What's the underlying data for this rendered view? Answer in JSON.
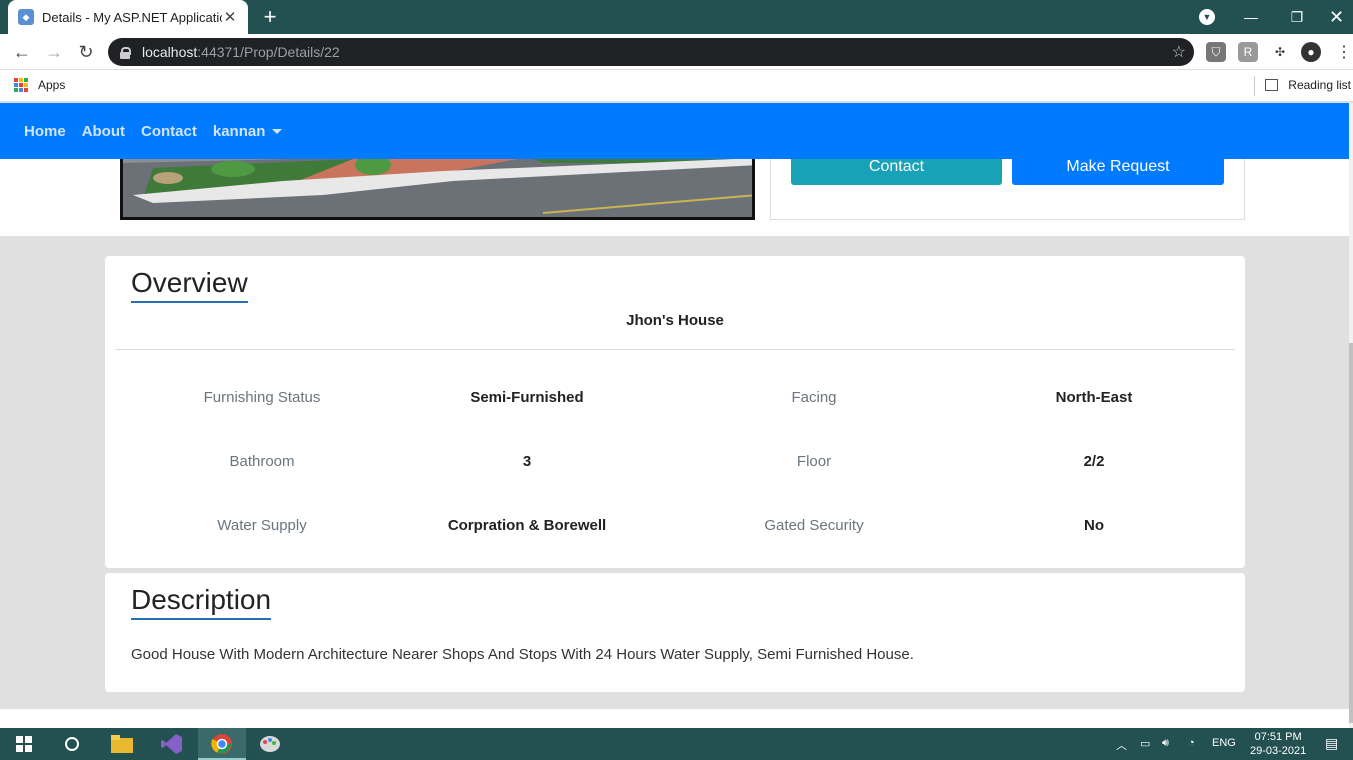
{
  "browser": {
    "tab_title": "Details - My ASP.NET Application",
    "url_host": "localhost",
    "url_path": ":44371/Prop/Details/22",
    "bookmarks_apps": "Apps",
    "reading_list": "Reading list"
  },
  "nav": {
    "home": "Home",
    "about": "About",
    "contact": "Contact",
    "user": "kannan"
  },
  "actions": {
    "contact": "Contact",
    "make_request": "Make Request"
  },
  "overview": {
    "heading": "Overview",
    "property_name": "Jhon's House",
    "specs": [
      {
        "label_a": "Furnishing Status",
        "value_a": "Semi-Furnished",
        "label_b": "Facing",
        "value_b": "North-East"
      },
      {
        "label_a": "Bathroom",
        "value_a": "3",
        "label_b": "Floor",
        "value_b": "2/2"
      },
      {
        "label_a": "Water Supply",
        "value_a": "Corpration & Borewell",
        "label_b": "Gated Security",
        "value_b": "No"
      }
    ]
  },
  "description": {
    "heading": "Description",
    "text": "Good House With Modern Architecture Nearer Shops And Stops With 24 Hours Water Supply, Semi Furnished House."
  },
  "taskbar": {
    "lang": "ENG",
    "time": "07:51 PM",
    "date": "29-03-2021"
  },
  "colors": {
    "primary": "#007bff",
    "info": "#17a2b8",
    "chrome": "#235050"
  }
}
